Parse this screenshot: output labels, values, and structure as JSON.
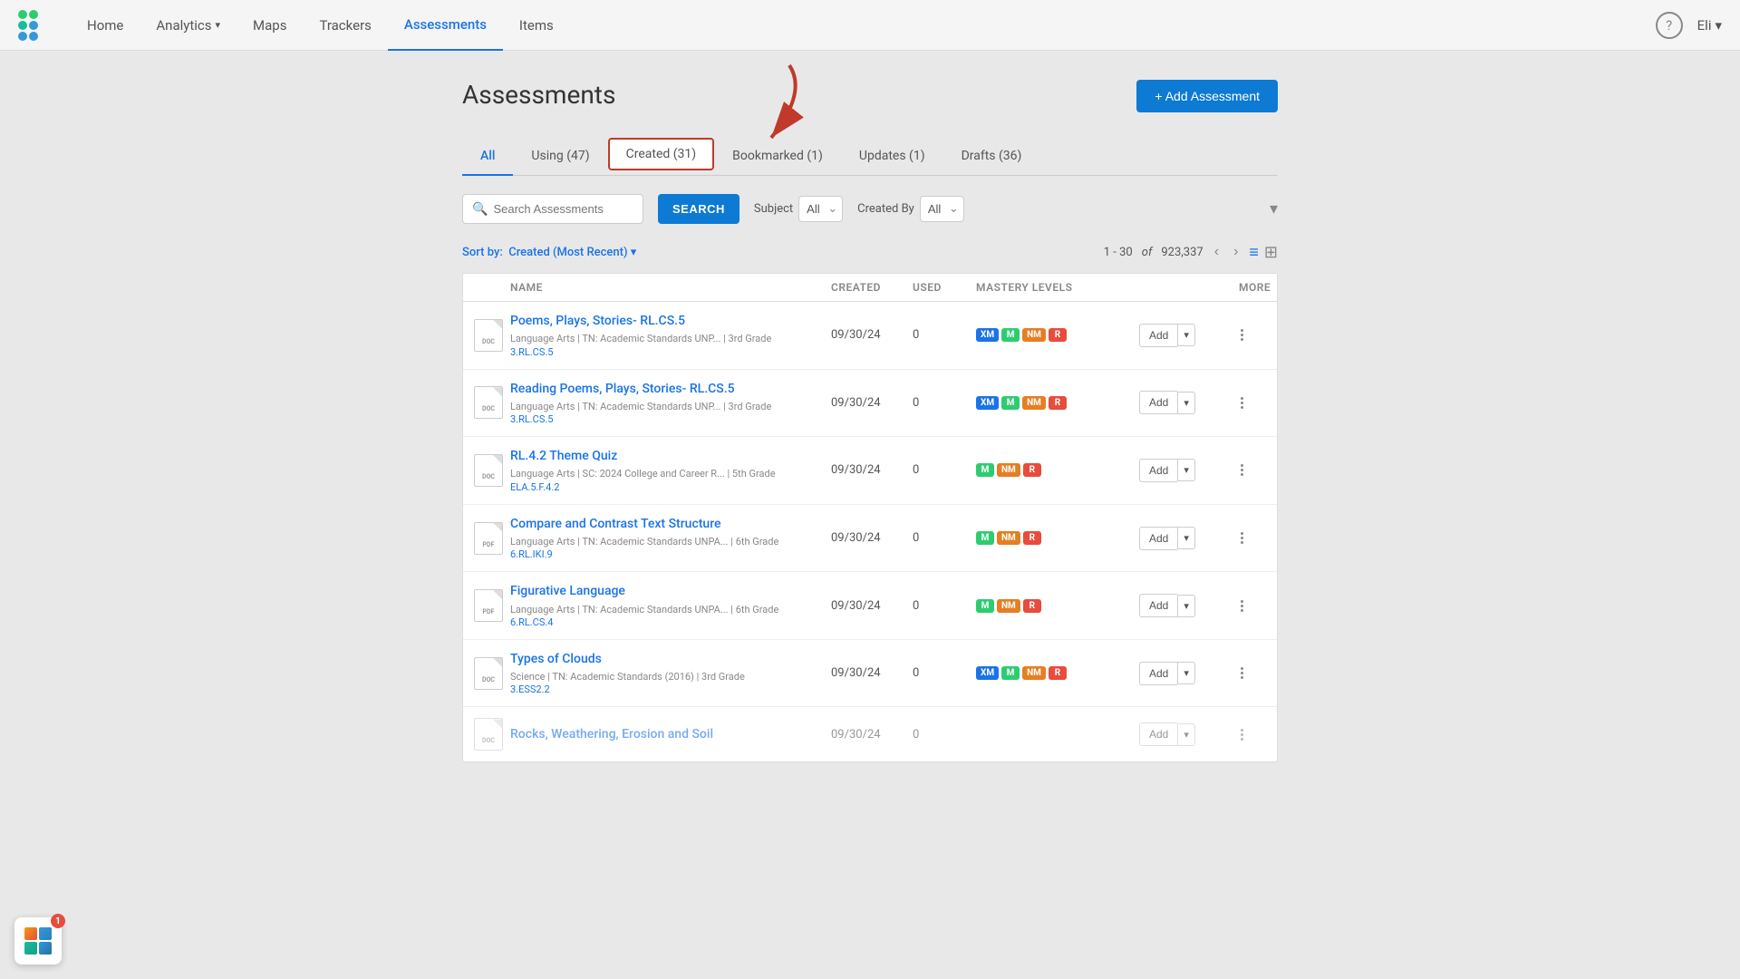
{
  "nav": {
    "home_label": "Home",
    "analytics_label": "Analytics",
    "maps_label": "Maps",
    "trackers_label": "Trackers",
    "assessments_label": "Assessments",
    "items_label": "Items",
    "user_label": "Eli",
    "help_label": "?"
  },
  "page": {
    "title": "Assessments",
    "add_button": "+ Add Assessment"
  },
  "tabs": [
    {
      "id": "all",
      "label": "All"
    },
    {
      "id": "using",
      "label": "Using (47)"
    },
    {
      "id": "created",
      "label": "Created (31)"
    },
    {
      "id": "bookmarked",
      "label": "Bookmarked (1)"
    },
    {
      "id": "updates",
      "label": "Updates (1)"
    },
    {
      "id": "drafts",
      "label": "Drafts (36)"
    }
  ],
  "search": {
    "placeholder": "Search Assessments",
    "button_label": "SEARCH",
    "subject_label": "Subject",
    "subject_value": "All",
    "created_by_label": "Created By",
    "created_by_value": "All"
  },
  "sort": {
    "label": "Sort by:",
    "value": "Created (Most Recent)"
  },
  "pagination": {
    "range": "1 - 30",
    "of_label": "of",
    "total": "923,337"
  },
  "columns": {
    "name": "NAME",
    "created": "CREATED",
    "used": "USED",
    "mastery": "MASTERY LEVELS",
    "more": "MORE"
  },
  "assessments": [
    {
      "id": 1,
      "type": "DOC",
      "name": "Poems, Plays, Stories- RL.CS.5",
      "meta": "Language Arts  |  TN: Academic Standards UNP...  |  3rd Grade",
      "standard": "3.RL.CS.5",
      "created": "09/30/24",
      "used": "0",
      "badges": [
        "XM",
        "M",
        "NM",
        "R"
      ],
      "badge_types": [
        "xm",
        "m",
        "nm",
        "r"
      ]
    },
    {
      "id": 2,
      "type": "DOC",
      "name": "Reading Poems, Plays, Stories- RL.CS.5",
      "meta": "Language Arts  |  TN: Academic Standards UNP...  |  3rd Grade",
      "standard": "3.RL.CS.5",
      "created": "09/30/24",
      "used": "0",
      "badges": [
        "XM",
        "M",
        "NM",
        "R"
      ],
      "badge_types": [
        "xm",
        "m",
        "nm",
        "r"
      ]
    },
    {
      "id": 3,
      "type": "DOC",
      "name": "RL.4.2 Theme Quiz",
      "meta": "Language Arts  |  SC: 2024 College and Career R...  |  5th Grade",
      "standard": "ELA.5.F.4.2",
      "created": "09/30/24",
      "used": "0",
      "badges": [
        "M",
        "NM",
        "R"
      ],
      "badge_types": [
        "m",
        "nm",
        "r"
      ]
    },
    {
      "id": 4,
      "type": "PDF",
      "name": "Compare and Contrast Text Structure",
      "meta": "Language Arts  |  TN: Academic Standards UNPA...  |  6th Grade",
      "standard": "6.RL.IKI.9",
      "created": "09/30/24",
      "used": "0",
      "badges": [
        "M",
        "NM",
        "R"
      ],
      "badge_types": [
        "m",
        "nm",
        "r"
      ]
    },
    {
      "id": 5,
      "type": "PDF",
      "name": "Figurative Language",
      "meta": "Language Arts  |  TN: Academic Standards UNPA...  |  6th Grade",
      "standard": "6.RL.CS.4",
      "created": "09/30/24",
      "used": "0",
      "badges": [
        "M",
        "NM",
        "R"
      ],
      "badge_types": [
        "m",
        "nm",
        "r"
      ]
    },
    {
      "id": 6,
      "type": "DOC",
      "name": "Types of Clouds",
      "meta": "Science  |  TN: Academic Standards (2016)  |  3rd Grade",
      "standard": "3.ESS2.2",
      "created": "09/30/24",
      "used": "0",
      "badges": [
        "XM",
        "M",
        "NM",
        "R"
      ],
      "badge_types": [
        "xm",
        "m",
        "nm",
        "r"
      ]
    },
    {
      "id": 7,
      "type": "DOC",
      "name": "Rocks, Weathering, Erosion and Soil",
      "meta": "",
      "standard": "",
      "created": "09/30/24",
      "used": "0",
      "badges": [],
      "badge_types": []
    }
  ],
  "notification_count": "1",
  "logo": {
    "tooltip": "App Logo"
  }
}
